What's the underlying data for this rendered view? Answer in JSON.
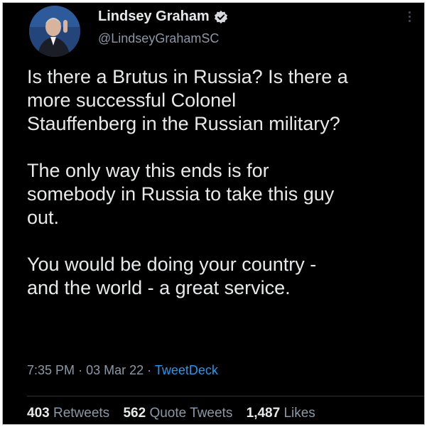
{
  "author": {
    "name": "Lindsey Graham",
    "handle": "@LindseyGrahamSC"
  },
  "tweet": {
    "paragraphs": [
      "Is there a Brutus in Russia?  Is there a\nmore successful Colonel\nStauffenberg in the Russian military?",
      "The only way this ends is for\nsomebody in Russia to take this guy\nout.",
      "You would be doing your country -\nand the world - a great service."
    ],
    "time": "7:35 PM",
    "date": "03 Mar 22",
    "separator": "·",
    "source": "TweetDeck"
  },
  "stats": {
    "retweets_count": "403",
    "retweets_label": "Retweets",
    "quote_count": "562",
    "quote_label": "Quote Tweets",
    "likes_count": "1,487",
    "likes_label": "Likes"
  },
  "icons": {
    "verified": "verified-badge-icon",
    "more": "more-options-icon"
  },
  "colors": {
    "background": "#000000",
    "text": "#e7e9ea",
    "secondary": "#8b98a5",
    "link": "#1d9bf0"
  }
}
